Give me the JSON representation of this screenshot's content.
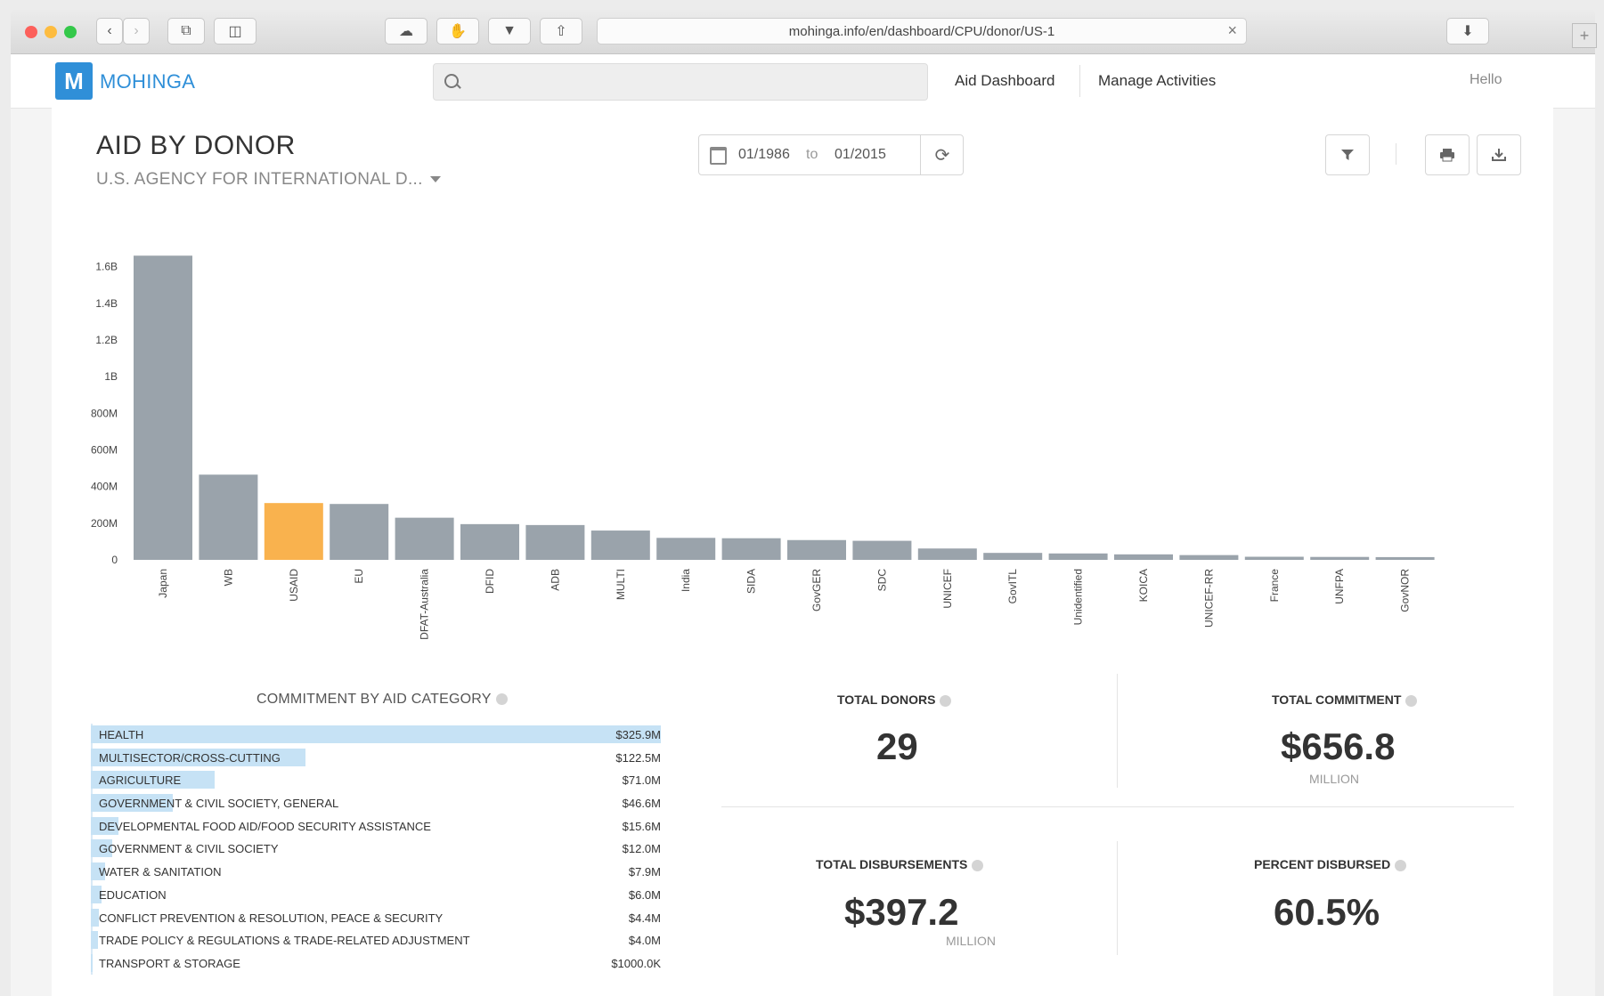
{
  "browser": {
    "url": "mohinga.info/en/dashboard/CPU/donor/US-1",
    "plus": "+"
  },
  "nav": {
    "logo_letter": "M",
    "logo_text": "MOHINGA",
    "links": [
      "Aid Dashboard",
      "Manage Activities"
    ],
    "hello": "Hello"
  },
  "header": {
    "title": "AID BY DONOR",
    "subtitle": "U.S. AGENCY FOR INTERNATIONAL D...",
    "date_from": "01/1986",
    "date_to_word": "to",
    "date_to": "01/2015"
  },
  "colors": {
    "bar": "#9aa3ab",
    "highlight": "#f9b24e",
    "category_bar": "#c6e2f5",
    "brand": "#2f8fd8"
  },
  "chart_data": {
    "type": "bar",
    "categories": [
      "Japan",
      "WB",
      "USAID",
      "EU",
      "DFAT-Australia",
      "DFID",
      "ADB",
      "MULTI",
      "India",
      "SIDA",
      "GovGER",
      "SDC",
      "UNICEF",
      "GovITL",
      "Unidentified",
      "KOICA",
      "UNICEF-RR",
      "France",
      "UNFPA",
      "GovNOR"
    ],
    "values": [
      1660,
      465,
      310,
      305,
      230,
      195,
      190,
      160,
      120,
      118,
      108,
      104,
      62,
      38,
      35,
      30,
      26,
      17,
      16,
      15
    ],
    "unit": "millions",
    "highlight": "USAID",
    "ylim": [
      0,
      1700
    ],
    "yticks": [
      0,
      200,
      400,
      600,
      800,
      1000,
      1200,
      1400,
      1600
    ],
    "ytick_labels": [
      "0",
      "200M",
      "400M",
      "600M",
      "800M",
      "1B",
      "1.2B",
      "1.4B",
      "1.6B"
    ],
    "grid": false,
    "title": "",
    "xlabel": "",
    "ylabel": ""
  },
  "categories_panel": {
    "title": "COMMITMENT BY AID CATEGORY",
    "rows": [
      {
        "label": "HEALTH",
        "value": "$325.9M",
        "amount": 325.9
      },
      {
        "label": "MULTISECTOR/CROSS-CUTTING",
        "value": "$122.5M",
        "amount": 122.5
      },
      {
        "label": "AGRICULTURE",
        "value": "$71.0M",
        "amount": 71.0
      },
      {
        "label": "GOVERNMENT & CIVIL SOCIETY, GENERAL",
        "value": "$46.6M",
        "amount": 46.6
      },
      {
        "label": "DEVELOPMENTAL FOOD AID/FOOD SECURITY ASSISTANCE",
        "value": "$15.6M",
        "amount": 15.6
      },
      {
        "label": "GOVERNMENT & CIVIL SOCIETY",
        "value": "$12.0M",
        "amount": 12.0
      },
      {
        "label": "WATER & SANITATION",
        "value": "$7.9M",
        "amount": 7.9
      },
      {
        "label": "EDUCATION",
        "value": "$6.0M",
        "amount": 6.0
      },
      {
        "label": "CONFLICT PREVENTION & RESOLUTION, PEACE & SECURITY",
        "value": "$4.4M",
        "amount": 4.4
      },
      {
        "label": "TRADE POLICY & REGULATIONS & TRADE-RELATED ADJUSTMENT",
        "value": "$4.0M",
        "amount": 4.0
      },
      {
        "label": "TRANSPORT & STORAGE",
        "value": "$1000.0K",
        "amount": 1.0
      }
    ]
  },
  "stats": {
    "total_donors": {
      "label": "TOTAL DONORS",
      "value": "29"
    },
    "total_commitment": {
      "label": "TOTAL COMMITMENT",
      "value": "$656.8",
      "unit": "MILLION"
    },
    "total_disbursements": {
      "label": "TOTAL DISBURSEMENTS",
      "value": "$397.2",
      "unit": "MILLION"
    },
    "percent_disbursed": {
      "label": "PERCENT DISBURSED",
      "value": "60.5%"
    }
  }
}
